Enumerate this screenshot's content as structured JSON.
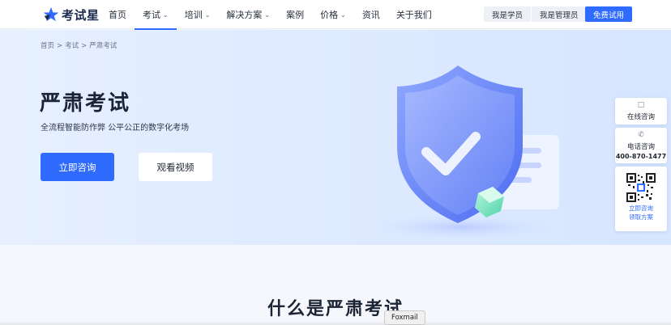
{
  "header": {
    "logo_text": "考试星",
    "nav": [
      {
        "label": "首页",
        "has_dropdown": false,
        "active": false
      },
      {
        "label": "考试",
        "has_dropdown": true,
        "active": true
      },
      {
        "label": "培训",
        "has_dropdown": true,
        "active": false
      },
      {
        "label": "解决方案",
        "has_dropdown": true,
        "active": false
      },
      {
        "label": "案例",
        "has_dropdown": false,
        "active": false
      },
      {
        "label": "价格",
        "has_dropdown": true,
        "active": false
      },
      {
        "label": "资讯",
        "has_dropdown": false,
        "active": false
      },
      {
        "label": "关于我们",
        "has_dropdown": false,
        "active": false
      }
    ],
    "student_btn": "我是学员",
    "admin_btn": "我是管理员",
    "trial_btn": "免费试用"
  },
  "breadcrumb": [
    "首页",
    ">",
    "考试",
    ">",
    "严肃考试"
  ],
  "hero": {
    "title": "严肃考试",
    "subtitle": "全流程智能防作弊 公平公正的数字化考场",
    "primary_btn": "立即咨询",
    "secondary_btn": "观看视频"
  },
  "section": {
    "title": "什么是严肃考试"
  },
  "float_panel": {
    "online_icon": "chat-icon",
    "online_label": "在线咨询",
    "phone_icon": "phone-icon",
    "phone_label": "电话咨询",
    "phone_number": "400-870-1477",
    "qr_caption_1": "立即咨询",
    "qr_caption_2": "领取方案"
  },
  "tooltip": "Foxmail",
  "colors": {
    "accent": "#2f6bff",
    "hero_bg": "#dfeaff",
    "title": "#1b2435"
  }
}
